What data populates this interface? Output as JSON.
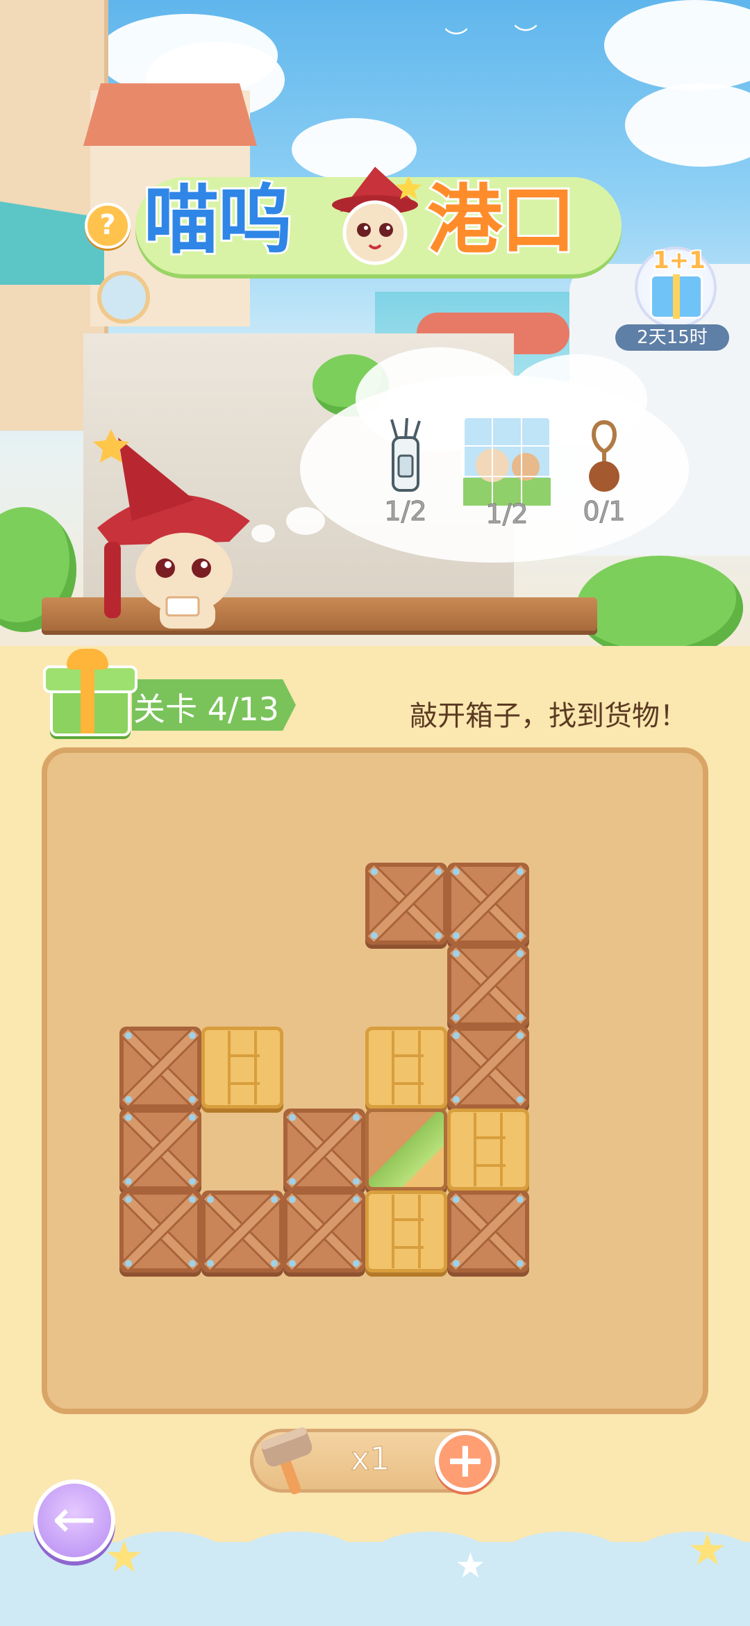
{
  "header": {
    "title_left": "喵呜",
    "title_right": "港口",
    "help_icon": "?",
    "promo": {
      "label": "1+1",
      "timer": "2天15时"
    }
  },
  "goals": [
    {
      "item": "golf-bag-icon",
      "count": "1/2"
    },
    {
      "item": "puzzle-picture-icon",
      "count": "1/2"
    },
    {
      "item": "bag-charm-icon",
      "count": "0/1"
    }
  ],
  "level": {
    "label": "关卡 4/13"
  },
  "instruction": "敲开箱子，找到货物！",
  "hammer": {
    "count": "x1",
    "plus": "+"
  },
  "footer": {
    "back_icon": "←"
  },
  "colors": {
    "crate": "#c98457",
    "plank": "#f1c36a",
    "board": "#e9c289",
    "accent_green": "#7ac35a"
  },
  "board": {
    "cols": 6,
    "rows": 6,
    "tiles": [
      {
        "col": 3,
        "row": 0,
        "kind": "crate"
      },
      {
        "col": 4,
        "row": 0,
        "kind": "crate"
      },
      {
        "col": 4,
        "row": 1,
        "kind": "crate"
      },
      {
        "col": 0,
        "row": 2,
        "kind": "crate"
      },
      {
        "col": 1,
        "row": 2,
        "kind": "plank"
      },
      {
        "col": 3,
        "row": 2,
        "kind": "plank"
      },
      {
        "col": 4,
        "row": 2,
        "kind": "crate"
      },
      {
        "col": 0,
        "row": 3,
        "kind": "crate"
      },
      {
        "col": 2,
        "row": 3,
        "kind": "crate"
      },
      {
        "col": 3,
        "row": 3,
        "kind": "broken"
      },
      {
        "col": 4,
        "row": 3,
        "kind": "plank"
      },
      {
        "col": 0,
        "row": 4,
        "kind": "crate"
      },
      {
        "col": 1,
        "row": 4,
        "kind": "crate"
      },
      {
        "col": 2,
        "row": 4,
        "kind": "crate"
      },
      {
        "col": 3,
        "row": 4,
        "kind": "plank"
      },
      {
        "col": 4,
        "row": 4,
        "kind": "crate"
      }
    ]
  }
}
